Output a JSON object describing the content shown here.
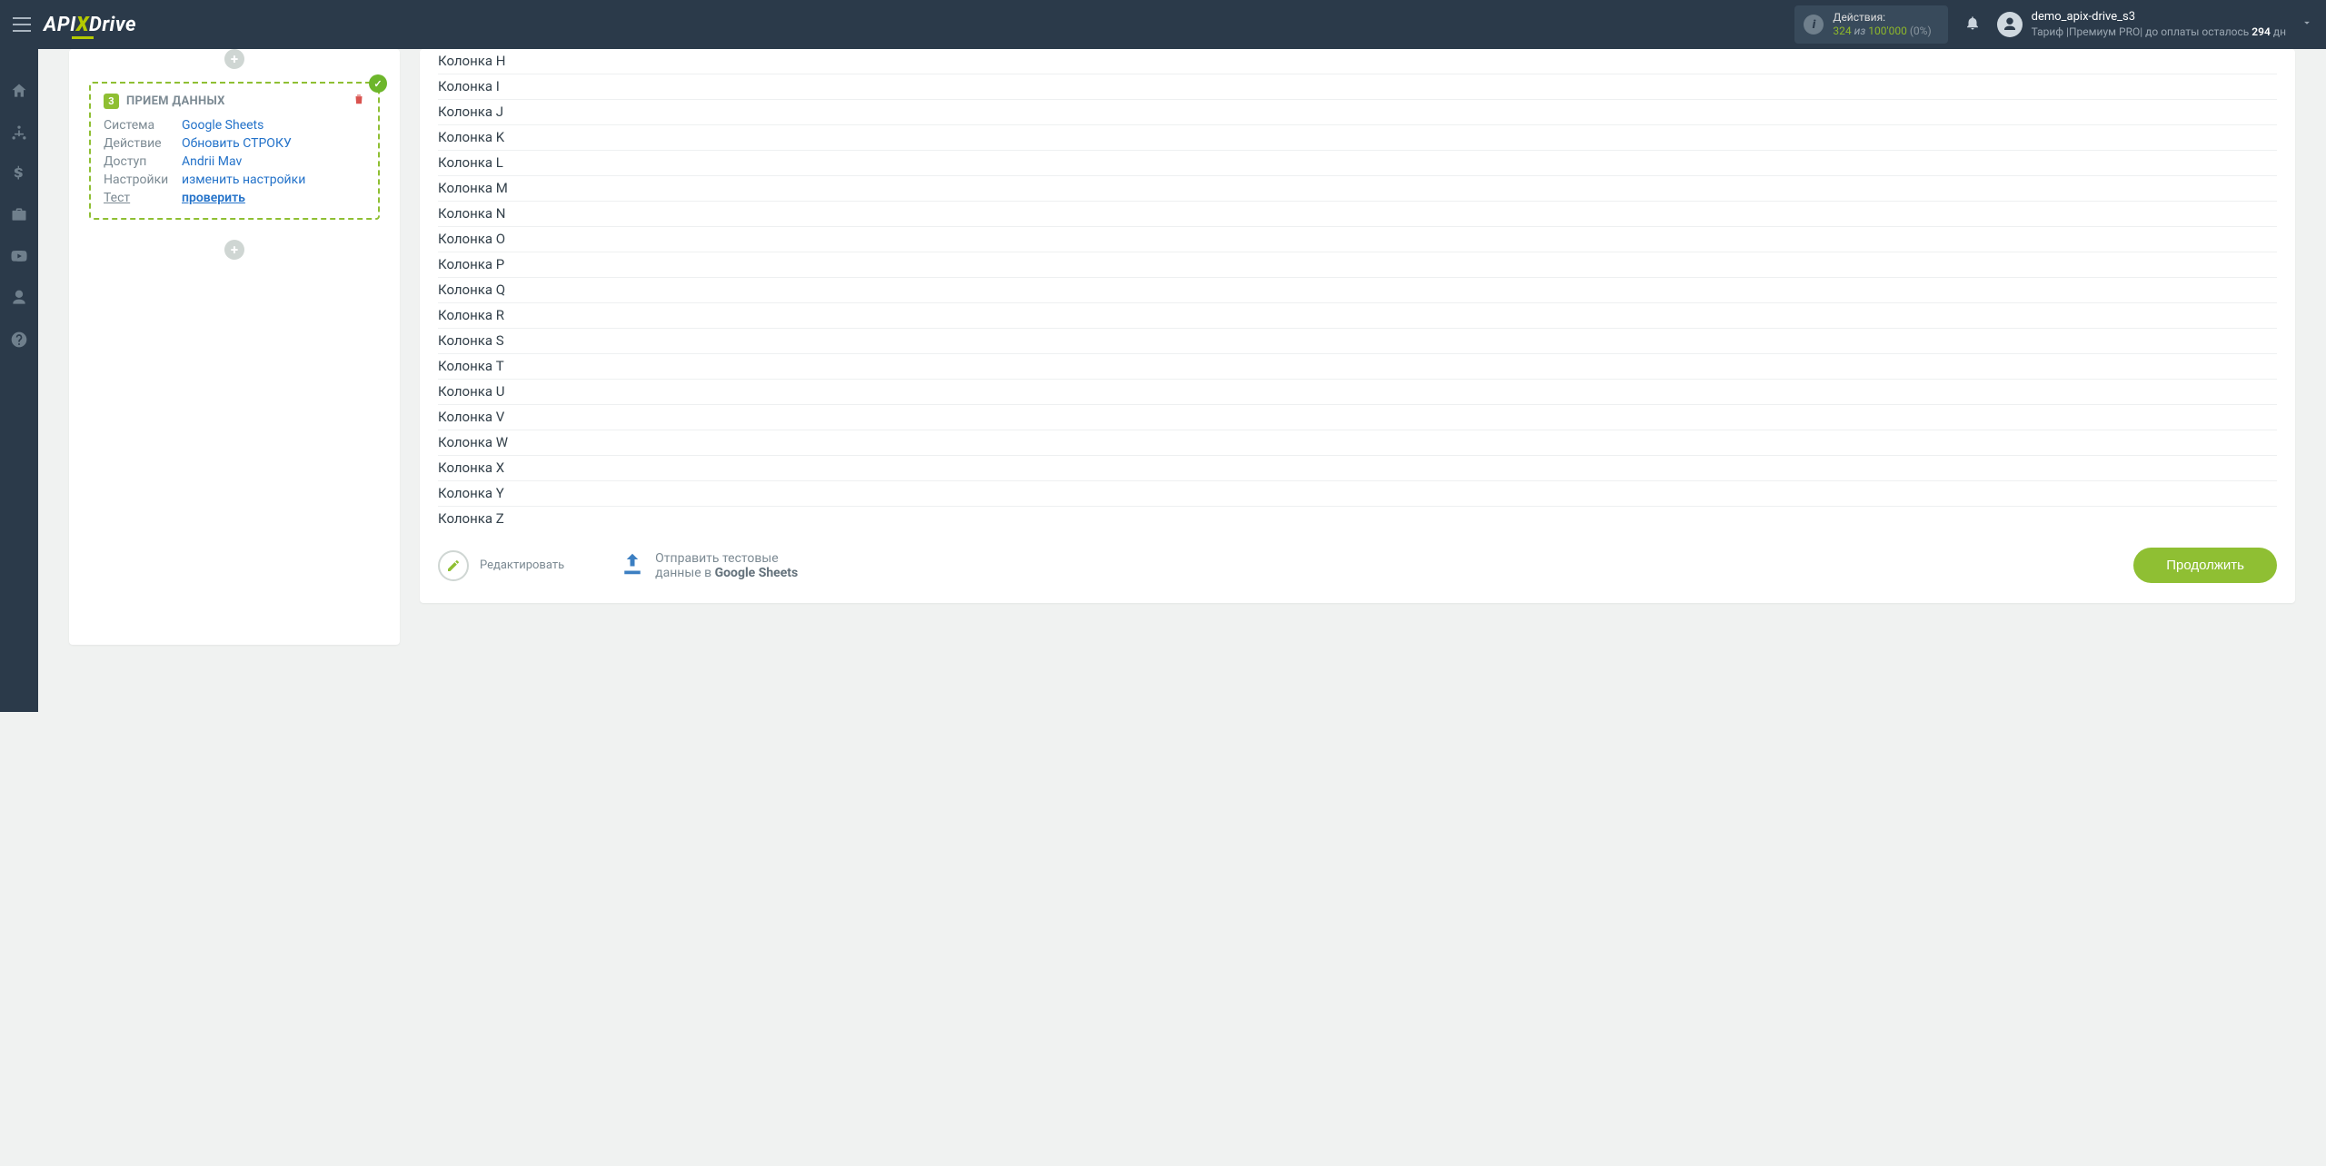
{
  "header": {
    "logo_a": "API",
    "logo_x": "X",
    "logo_b": "Drive",
    "actions": {
      "title": "Действия:",
      "used": "324",
      "of_word": "из",
      "max": "100'000",
      "pct": "(0%)"
    },
    "user": {
      "name": "demo_apix-drive_s3",
      "tariff_prefix": "Тариф |",
      "tariff_name": "Премиум PRO",
      "pay_prefix": "| до оплаты осталось ",
      "days_num": "294",
      "days_suffix": " дн"
    }
  },
  "step": {
    "number": "3",
    "title": "ПРИЕМ ДАННЫХ",
    "rows": {
      "system_lbl": "Система",
      "system_val": "Google Sheets",
      "action_lbl": "Действие",
      "action_val": "Обновить СТРОКУ",
      "access_lbl": "Доступ",
      "access_val": "Andrii Mav",
      "settings_lbl": "Настройки",
      "settings_val": "изменить настройки",
      "test_lbl": "Тест",
      "test_val": "проверить"
    }
  },
  "columns": [
    "Колонка H",
    "Колонка I",
    "Колонка J",
    "Колонка K",
    "Колонка L",
    "Колонка M",
    "Колонка N",
    "Колонка O",
    "Колонка P",
    "Колонка Q",
    "Колонка R",
    "Колонка S",
    "Колонка T",
    "Колонка U",
    "Колонка V",
    "Колонка W",
    "Колонка X",
    "Колонка Y",
    "Колонка Z"
  ],
  "footer": {
    "edit": "Редактировать",
    "send_l1": "Отправить тестовые",
    "send_l2a": "данные в ",
    "send_l2b": "Google Sheets",
    "continue": "Продолжить"
  },
  "plus": "+"
}
